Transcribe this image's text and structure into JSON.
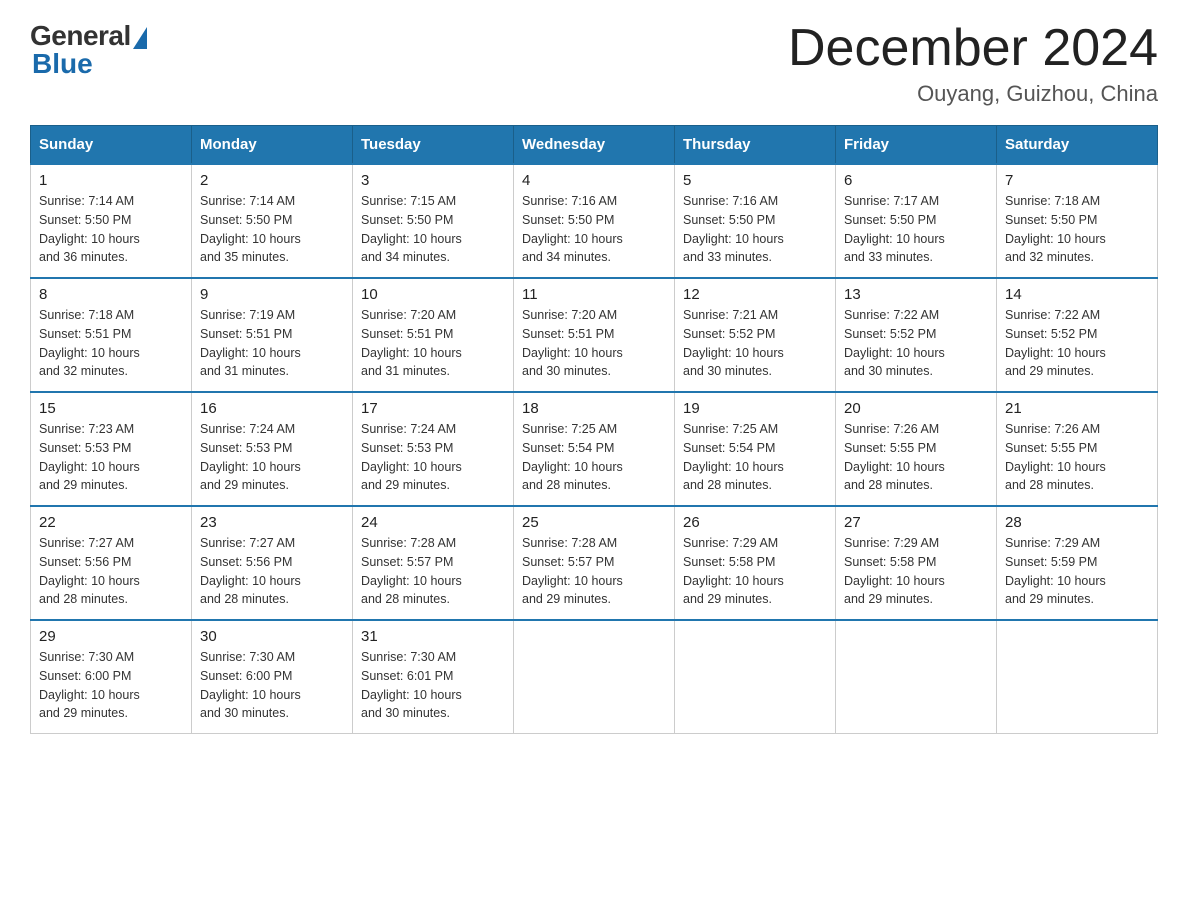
{
  "header": {
    "logo_general": "General",
    "logo_blue": "Blue",
    "month_year": "December 2024",
    "location": "Ouyang, Guizhou, China"
  },
  "days_of_week": [
    "Sunday",
    "Monday",
    "Tuesday",
    "Wednesday",
    "Thursday",
    "Friday",
    "Saturday"
  ],
  "weeks": [
    [
      {
        "day": "1",
        "sunrise": "7:14 AM",
        "sunset": "5:50 PM",
        "daylight": "10 hours and 36 minutes."
      },
      {
        "day": "2",
        "sunrise": "7:14 AM",
        "sunset": "5:50 PM",
        "daylight": "10 hours and 35 minutes."
      },
      {
        "day": "3",
        "sunrise": "7:15 AM",
        "sunset": "5:50 PM",
        "daylight": "10 hours and 34 minutes."
      },
      {
        "day": "4",
        "sunrise": "7:16 AM",
        "sunset": "5:50 PM",
        "daylight": "10 hours and 34 minutes."
      },
      {
        "day": "5",
        "sunrise": "7:16 AM",
        "sunset": "5:50 PM",
        "daylight": "10 hours and 33 minutes."
      },
      {
        "day": "6",
        "sunrise": "7:17 AM",
        "sunset": "5:50 PM",
        "daylight": "10 hours and 33 minutes."
      },
      {
        "day": "7",
        "sunrise": "7:18 AM",
        "sunset": "5:50 PM",
        "daylight": "10 hours and 32 minutes."
      }
    ],
    [
      {
        "day": "8",
        "sunrise": "7:18 AM",
        "sunset": "5:51 PM",
        "daylight": "10 hours and 32 minutes."
      },
      {
        "day": "9",
        "sunrise": "7:19 AM",
        "sunset": "5:51 PM",
        "daylight": "10 hours and 31 minutes."
      },
      {
        "day": "10",
        "sunrise": "7:20 AM",
        "sunset": "5:51 PM",
        "daylight": "10 hours and 31 minutes."
      },
      {
        "day": "11",
        "sunrise": "7:20 AM",
        "sunset": "5:51 PM",
        "daylight": "10 hours and 30 minutes."
      },
      {
        "day": "12",
        "sunrise": "7:21 AM",
        "sunset": "5:52 PM",
        "daylight": "10 hours and 30 minutes."
      },
      {
        "day": "13",
        "sunrise": "7:22 AM",
        "sunset": "5:52 PM",
        "daylight": "10 hours and 30 minutes."
      },
      {
        "day": "14",
        "sunrise": "7:22 AM",
        "sunset": "5:52 PM",
        "daylight": "10 hours and 29 minutes."
      }
    ],
    [
      {
        "day": "15",
        "sunrise": "7:23 AM",
        "sunset": "5:53 PM",
        "daylight": "10 hours and 29 minutes."
      },
      {
        "day": "16",
        "sunrise": "7:24 AM",
        "sunset": "5:53 PM",
        "daylight": "10 hours and 29 minutes."
      },
      {
        "day": "17",
        "sunrise": "7:24 AM",
        "sunset": "5:53 PM",
        "daylight": "10 hours and 29 minutes."
      },
      {
        "day": "18",
        "sunrise": "7:25 AM",
        "sunset": "5:54 PM",
        "daylight": "10 hours and 28 minutes."
      },
      {
        "day": "19",
        "sunrise": "7:25 AM",
        "sunset": "5:54 PM",
        "daylight": "10 hours and 28 minutes."
      },
      {
        "day": "20",
        "sunrise": "7:26 AM",
        "sunset": "5:55 PM",
        "daylight": "10 hours and 28 minutes."
      },
      {
        "day": "21",
        "sunrise": "7:26 AM",
        "sunset": "5:55 PM",
        "daylight": "10 hours and 28 minutes."
      }
    ],
    [
      {
        "day": "22",
        "sunrise": "7:27 AM",
        "sunset": "5:56 PM",
        "daylight": "10 hours and 28 minutes."
      },
      {
        "day": "23",
        "sunrise": "7:27 AM",
        "sunset": "5:56 PM",
        "daylight": "10 hours and 28 minutes."
      },
      {
        "day": "24",
        "sunrise": "7:28 AM",
        "sunset": "5:57 PM",
        "daylight": "10 hours and 28 minutes."
      },
      {
        "day": "25",
        "sunrise": "7:28 AM",
        "sunset": "5:57 PM",
        "daylight": "10 hours and 29 minutes."
      },
      {
        "day": "26",
        "sunrise": "7:29 AM",
        "sunset": "5:58 PM",
        "daylight": "10 hours and 29 minutes."
      },
      {
        "day": "27",
        "sunrise": "7:29 AM",
        "sunset": "5:58 PM",
        "daylight": "10 hours and 29 minutes."
      },
      {
        "day": "28",
        "sunrise": "7:29 AM",
        "sunset": "5:59 PM",
        "daylight": "10 hours and 29 minutes."
      }
    ],
    [
      {
        "day": "29",
        "sunrise": "7:30 AM",
        "sunset": "6:00 PM",
        "daylight": "10 hours and 29 minutes."
      },
      {
        "day": "30",
        "sunrise": "7:30 AM",
        "sunset": "6:00 PM",
        "daylight": "10 hours and 30 minutes."
      },
      {
        "day": "31",
        "sunrise": "7:30 AM",
        "sunset": "6:01 PM",
        "daylight": "10 hours and 30 minutes."
      },
      null,
      null,
      null,
      null
    ]
  ],
  "labels": {
    "sunrise": "Sunrise:",
    "sunset": "Sunset:",
    "daylight": "Daylight:"
  }
}
